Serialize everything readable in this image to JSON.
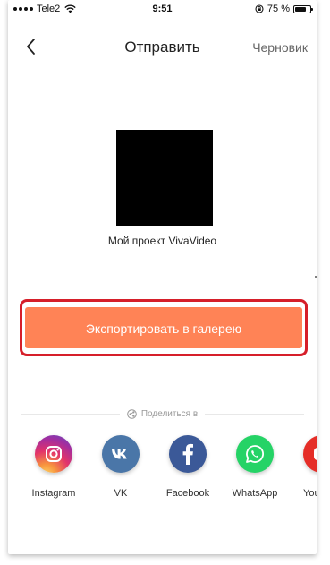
{
  "status_bar": {
    "carrier": "Tele2",
    "time": "9:51",
    "battery_percent": "75 %",
    "battery_level": 0.75
  },
  "nav": {
    "title": "Отправить",
    "draft_label": "Черновик",
    "back_icon": "chevron-left-icon"
  },
  "preview": {
    "project_name": "Мой проект VivaVideo"
  },
  "export": {
    "button_label": "Экспортировать в галерею",
    "button_color": "#ff8356",
    "highlight_color": "#d61f2a"
  },
  "share": {
    "heading": "Поделиться в",
    "targets": [
      {
        "label": "Instagram",
        "icon": "instagram-icon"
      },
      {
        "label": "VK",
        "icon": "vk-icon",
        "color": "#4a76a8"
      },
      {
        "label": "Facebook",
        "icon": "facebook-icon",
        "color": "#3b5998"
      },
      {
        "label": "WhatsApp",
        "icon": "whatsapp-icon",
        "color": "#25d366"
      },
      {
        "label": "You",
        "icon": "youtube-icon",
        "color": "#e52d27"
      }
    ]
  }
}
